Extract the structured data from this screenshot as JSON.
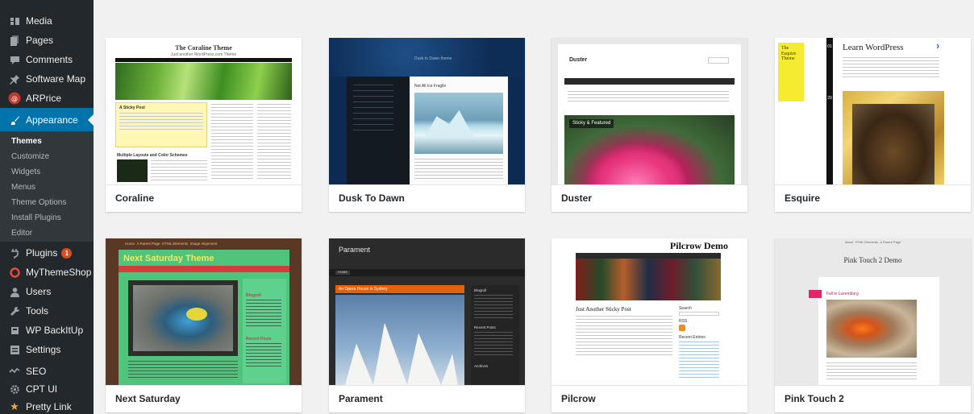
{
  "sidebar": {
    "items": [
      {
        "label": "Media",
        "icon": "media-icon"
      },
      {
        "label": "Pages",
        "icon": "pages-icon"
      },
      {
        "label": "Comments",
        "icon": "comments-icon"
      },
      {
        "label": "Software Map",
        "icon": "pin-icon"
      },
      {
        "label": "ARPrice",
        "icon": "arprice-icon"
      },
      {
        "label": "Appearance",
        "icon": "brush-icon",
        "active": true
      }
    ],
    "submenu": [
      "Themes",
      "Customize",
      "Widgets",
      "Menus",
      "Theme Options",
      "Install Plugins",
      "Editor"
    ],
    "items_after": [
      {
        "label": "Plugins",
        "icon": "plug-icon",
        "badge": "1"
      },
      {
        "label": "MyThemeShop",
        "icon": "mythemeshop-icon"
      },
      {
        "label": "Users",
        "icon": "users-icon"
      },
      {
        "label": "Tools",
        "icon": "wrench-icon"
      },
      {
        "label": "WP BackItUp",
        "icon": "backup-icon"
      },
      {
        "label": "Settings",
        "icon": "settings-icon"
      },
      {
        "label": "SEO",
        "icon": "seo-icon"
      },
      {
        "label": "CPT UI",
        "icon": "gear-icon"
      },
      {
        "label": "Pretty Link",
        "icon": "star-icon"
      }
    ],
    "colors": {
      "bg": "#23282d",
      "active": "#0073aa",
      "submenu_bg": "#32373c",
      "badge": "#d54e21"
    }
  },
  "themes": [
    {
      "name": "Coraline",
      "preview": {
        "title": "The Coraline Theme",
        "tagline": "Just another WordPress.com Theme",
        "post_title": "A Sticky Post",
        "post2_title": "Multiple Layouts and Color Schemes"
      }
    },
    {
      "name": "Dusk To Dawn",
      "preview": {
        "site_title": "Dusk to Dawn theme",
        "post_title": "Not All Ice Fragile"
      }
    },
    {
      "name": "Duster",
      "preview": {
        "site_title": "Duster",
        "caption": "Sticky & Featured"
      }
    },
    {
      "name": "Esquire",
      "preview": {
        "logo_text": "The Esquire Theme",
        "title": "Learn WordPress",
        "date1": "01",
        "date2": "29"
      }
    },
    {
      "name": "Next Saturday",
      "preview": {
        "title": "Next Saturday Theme",
        "nav": [
          "Home",
          "A Parent Page",
          "HTML Elements",
          "Image Alignment"
        ],
        "sidebar_heading": "Blogroll",
        "sidebar_heading2": "Recent Posts"
      }
    },
    {
      "name": "Parament",
      "preview": {
        "site_title": "Parament",
        "post_title": "An Opera House in Sydney",
        "nav_item": "HOME",
        "widget1": "Blogroll",
        "widget2": "Recent Posts",
        "widget3": "Archives"
      }
    },
    {
      "name": "Pilcrow",
      "preview": {
        "title": "Pilcrow Demo",
        "post_title": "Just Another Sticky Post",
        "widget1": "Search",
        "widget2": "RSS",
        "widget3": "Recent Entries"
      }
    },
    {
      "name": "Pink Touch 2",
      "preview": {
        "title": "Pink Touch 2 Demo",
        "post_title": "Fall in Luxemburg",
        "nav": [
          "About",
          "HTML Elements",
          "A Parent Page"
        ]
      }
    }
  ]
}
